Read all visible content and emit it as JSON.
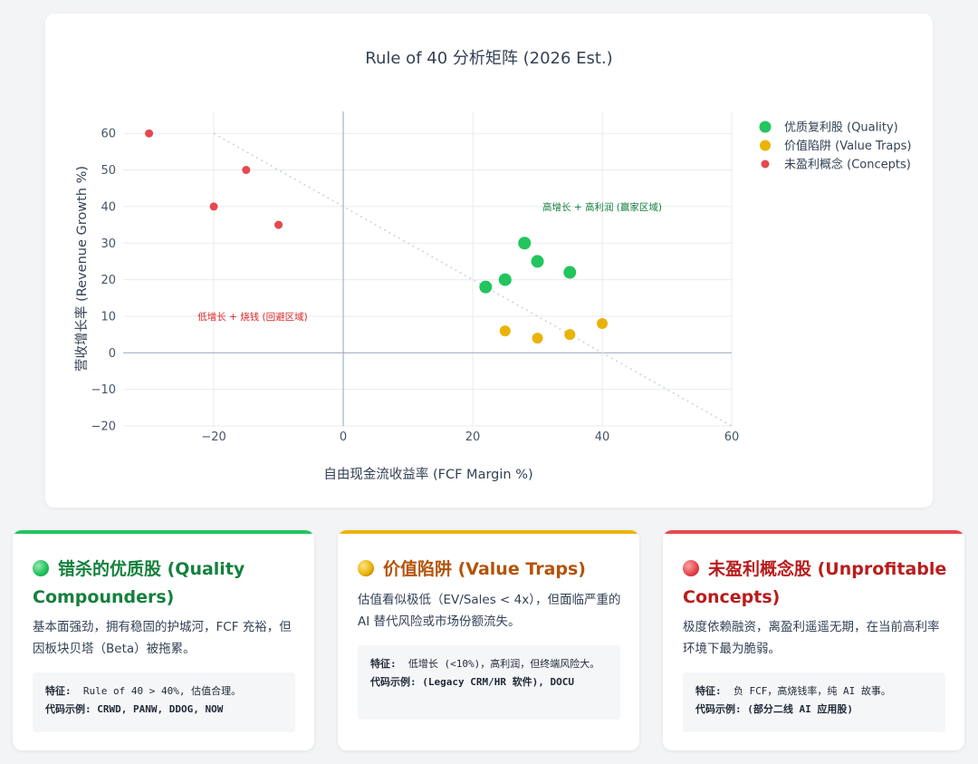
{
  "chart_data": {
    "type": "scatter",
    "title": "Rule of 40 分析矩阵 (2026 Est.)",
    "xlabel": "自由现金流收益率 (FCF Margin %)",
    "ylabel": "营收增长率 (Revenue Growth %)",
    "xlim": [
      -34,
      60
    ],
    "ylim": [
      -20,
      66
    ],
    "x_ticks": [
      -20,
      0,
      20,
      40,
      60
    ],
    "y_ticks": [
      -20,
      -10,
      0,
      10,
      20,
      30,
      40,
      50,
      60
    ],
    "x_tick_labels": [
      "−20",
      "0",
      "20",
      "40",
      "60"
    ],
    "y_tick_labels": [
      "−20",
      "−10",
      "0",
      "10",
      "20",
      "30",
      "40",
      "50",
      "60"
    ],
    "grid": true,
    "legend_position": "top-right",
    "series": [
      {
        "name": "优质复利股 (Quality)",
        "color": "#22c55e",
        "points": [
          [
            22,
            18
          ],
          [
            25,
            20
          ],
          [
            28,
            30
          ],
          [
            30,
            25
          ],
          [
            35,
            22
          ]
        ]
      },
      {
        "name": "价值陷阱 (Value Traps)",
        "color": "#eab308",
        "points": [
          [
            25,
            6
          ],
          [
            30,
            4
          ],
          [
            35,
            5
          ],
          [
            40,
            8
          ]
        ]
      },
      {
        "name": "未盈利概念 (Concepts)",
        "color": "#e5484d",
        "points": [
          [
            -30,
            60
          ],
          [
            -15,
            50
          ],
          [
            -20,
            40
          ],
          [
            -10,
            35
          ]
        ]
      }
    ],
    "reference_line": {
      "from": [
        -20,
        60
      ],
      "to": [
        60,
        -20
      ]
    },
    "annotations": [
      {
        "text": "高增长 + 高利润 (赢家区域)",
        "x": 40,
        "y": 40,
        "color": "#15803d"
      },
      {
        "text": "低增长 + 烧钱 (回避区域)",
        "x": -14,
        "y": 10,
        "color": "#dc2626"
      }
    ]
  },
  "cards": [
    {
      "color": "#22c55e",
      "title_color": "#15803d",
      "title": "错杀的优质股 (Quality Compounders)",
      "desc": "基本面强劲，拥有稳固的护城河，FCF 充裕，但因板块贝塔（Beta）被拖累。",
      "feature_label": "特征:",
      "feature": "Rule of 40 > 40%, 估值合理。",
      "example_label": "代码示例:",
      "example": "CRWD, PANW, DDOG, NOW"
    },
    {
      "color": "#eab308",
      "title_color": "#b45309",
      "title": "价值陷阱 (Value Traps)",
      "desc": "估值看似极低（EV/Sales < 4x），但面临严重的 AI 替代风险或市场份额流失。",
      "feature_label": "特征:",
      "feature": "低增长 (<10%)，高利润，但终端风险大。",
      "example_label": "代码示例:",
      "example": "(Legacy CRM/HR 软件), DOCU"
    },
    {
      "color": "#e5484d",
      "title_color": "#b91c1c",
      "title": "未盈利概念股 (Unprofitable Concepts)",
      "desc": "极度依赖融资，离盈利遥遥无期，在当前高利率环境下最为脆弱。",
      "feature_label": "特征:",
      "feature": "负 FCF，高烧钱率，纯 AI 故事。",
      "example_label": "代码示例:",
      "example": "(部分二线 AI 应用股)"
    }
  ]
}
